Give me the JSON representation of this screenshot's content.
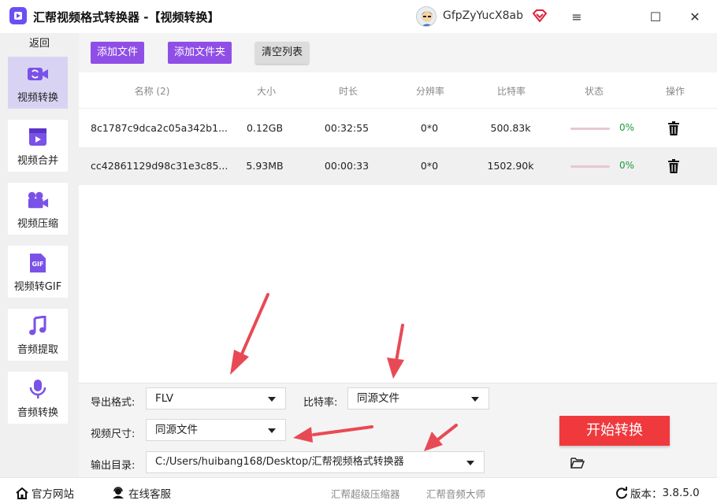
{
  "app": {
    "title": "汇帮视频格式转换器  -【视频转换】",
    "user_name": "GfpZyYucX8ab",
    "colors": {
      "accent": "#8f4fe6",
      "start": "#f0393d",
      "progress_ok": "#1a9a3a"
    }
  },
  "window_controls": {
    "menu_icon": "≡",
    "maximize_icon": "☐",
    "close_icon": "✕"
  },
  "sidebar": {
    "back_label": "返回",
    "items": [
      {
        "label": "视频转换",
        "icon": "video-convert-icon",
        "active": true
      },
      {
        "label": "视频合并",
        "icon": "video-merge-icon",
        "active": false
      },
      {
        "label": "视频压缩",
        "icon": "video-compress-icon",
        "active": false
      },
      {
        "label": "视频转GIF",
        "icon": "gif-icon",
        "active": false
      },
      {
        "label": "音频提取",
        "icon": "music-note-icon",
        "active": false
      },
      {
        "label": "音频转换",
        "icon": "microphone-icon",
        "active": false
      }
    ]
  },
  "toolbar": {
    "add_file": "添加文件",
    "add_folder": "添加文件夹",
    "clear_list": "清空列表"
  },
  "table": {
    "headers": {
      "name": "名称 (2)",
      "size": "大小",
      "duration": "时长",
      "resolution": "分辨率",
      "bitrate": "比特率",
      "status": "状态",
      "action": "操作"
    },
    "rows": [
      {
        "name": "8c1787c9dca2c05a342b1...",
        "size": "0.12GB",
        "duration": "00:32:55",
        "resolution": "0*0",
        "bitrate": "500.83k",
        "progress": "0%"
      },
      {
        "name": "cc42861129d98c31e3c85...",
        "size": "5.93MB",
        "duration": "00:00:33",
        "resolution": "0*0",
        "bitrate": "1502.90k",
        "progress": "0%"
      }
    ]
  },
  "settings": {
    "format_label": "导出格式:",
    "format_value": "FLV",
    "bitrate_label": "比特率:",
    "bitrate_value": "同源文件",
    "size_label": "视频尺寸:",
    "size_value": "同源文件",
    "output_label": "输出目录:",
    "output_value": "C:/Users/huibang168/Desktop/汇帮视频格式转换器",
    "start_button": "开始转换"
  },
  "statusbar": {
    "website": "官方网站",
    "support": "在线客服",
    "link1": "汇帮超级压缩器",
    "link2": "汇帮音频大师",
    "version_label": "版本：",
    "version": "3.8.5.0"
  }
}
